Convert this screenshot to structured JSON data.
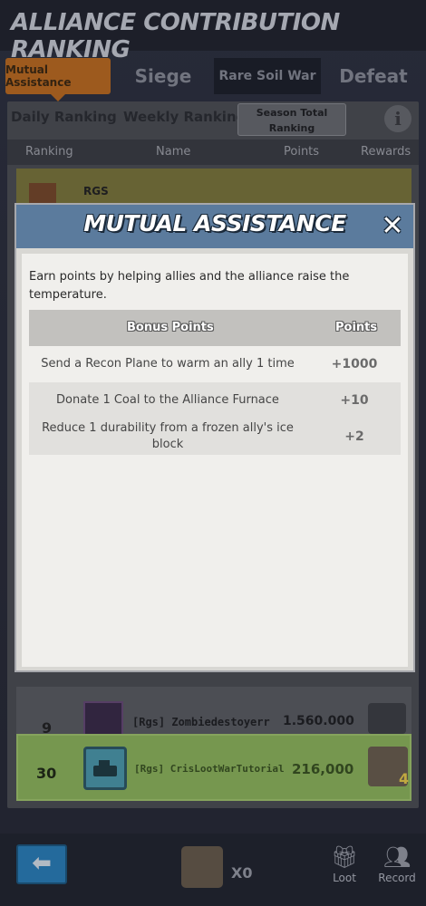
{
  "header": {
    "title": "ALLIANCE CONTRIBUTION RANKING"
  },
  "tabs": [
    {
      "label": "Mutual Assistance"
    },
    {
      "label": "Siege"
    },
    {
      "label": "Rare Soil War"
    },
    {
      "label": "Defeat"
    }
  ],
  "subtabs": [
    {
      "label": "Daily Ranking"
    },
    {
      "label": "Weekly Ranking"
    },
    {
      "label": "Season Total Ranking"
    }
  ],
  "columns": [
    "Ranking",
    "Name",
    "Points",
    "Rewards"
  ],
  "rows": {
    "top_tag": "RGS",
    "lower": {
      "rank": "9",
      "name": "[Rgs] Zombiedestoyerr",
      "points": "1.560.000"
    },
    "mine": {
      "rank": "30",
      "name": "[Rgs] CrisLootWarTutorial",
      "points": "216,000",
      "chest_count": "4"
    }
  },
  "bottom": {
    "loot_count": "X0",
    "loot_label": "Loot",
    "record_label": "Record",
    "back_glyph": "⬅"
  },
  "modal": {
    "title": "MUTUAL ASSISTANCE",
    "close_glyph": "✕",
    "description": "Earn points by helping allies and the alliance raise the temperature.",
    "table_header": {
      "task": "Bonus Points",
      "points": "Points"
    },
    "table_rows": [
      {
        "task": "Send a Recon Plane to warm an ally 1 time",
        "points": "+1000"
      },
      {
        "task": "Donate 1 Coal to the Alliance Furnace",
        "points": "+10"
      },
      {
        "task": "Reduce 1 durability from a frozen ally's ice block",
        "points": "+2"
      }
    ]
  },
  "colors": {
    "accent_tab": "#c46f1f",
    "modal_header": "#5b7b9d",
    "highlight_row": "#93bd5e"
  },
  "icons": [
    "info-icon",
    "close-icon",
    "back-arrow-icon",
    "loot-chest-icon",
    "gift-icon",
    "record-icon",
    "tank-avatar-icon"
  ]
}
